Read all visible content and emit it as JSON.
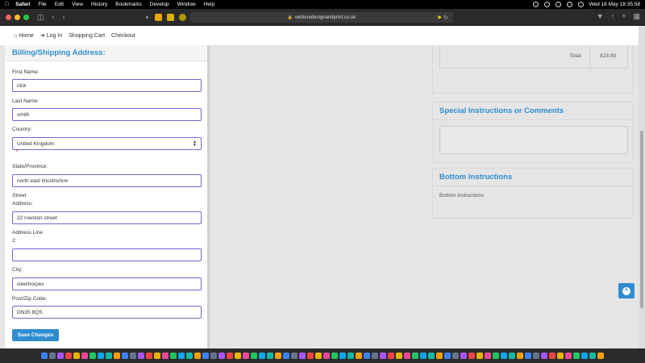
{
  "menubar": {
    "app_name": "Safari",
    "menus": [
      "File",
      "Edit",
      "View",
      "History",
      "Bookmarks",
      "Develop",
      "Window",
      "Help"
    ],
    "clock": "Wed 18 May  18:35:58"
  },
  "browser": {
    "url": "venturedesignandprint.co.uk"
  },
  "nav": {
    "items": [
      {
        "label": "Home",
        "icon": "home-icon"
      },
      {
        "label": "Log In",
        "icon": "sign-in-icon"
      },
      {
        "label": "Shopping Cart",
        "icon": ""
      },
      {
        "label": "Checkout",
        "icon": ""
      }
    ]
  },
  "billing": {
    "title": "Billing/Shipping Address:",
    "first_name_label": "First Name:",
    "first_name_value": "nick",
    "last_name_label": "Last Name:",
    "last_name_value": "smith",
    "country_label": "Country:",
    "country_value": "United Kingdom",
    "required_mark": "*",
    "state_label": "State/Province:",
    "state_value": "north east lincolnshire",
    "street_label_1": "Street",
    "street_label_2": "Address:",
    "street_value": "22 rowston street",
    "line2_label_1": "Address Line",
    "line2_label_2": "2:",
    "line2_value": "",
    "city_label": "City:",
    "city_value": "cleethorpes",
    "post_label": "Post/Zip Code:",
    "post_value": "DN35 8QS",
    "save_label": "Save Changes"
  },
  "summary": {
    "total_label": "Total:",
    "total_value": "£23.99"
  },
  "special": {
    "title": "Special Instructions or Comments"
  },
  "bottom": {
    "title": "Bottom Instructions",
    "text": "Bottom instructions"
  },
  "colors": {
    "accent": "#2e8dcf",
    "input_border": "#6b6bd9",
    "page_bg": "#e5e5e5"
  }
}
